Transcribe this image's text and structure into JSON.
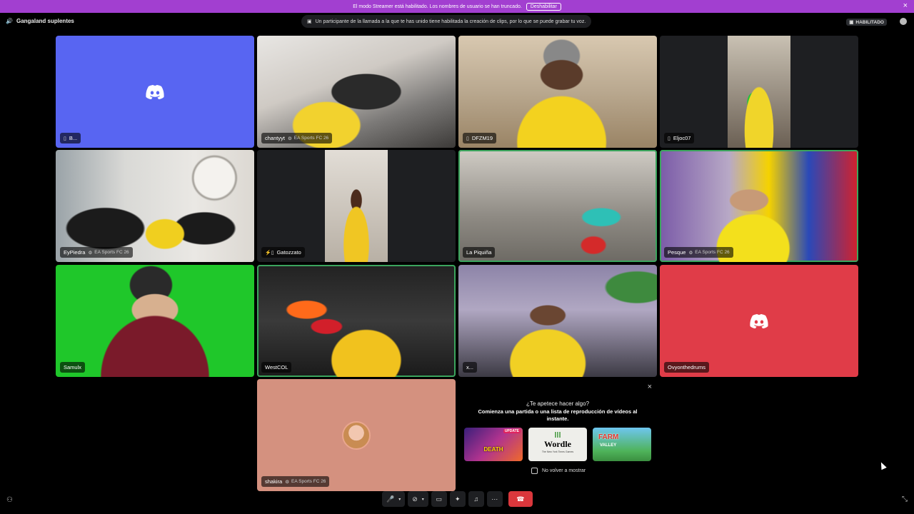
{
  "banner": {
    "text": "El modo Streamer está habilitado. Los nombres de usuario se han truncado.",
    "button": "Deshabilitar",
    "close_icon": "close-icon"
  },
  "topbar": {
    "channel": "Gangaland suplentes",
    "notice": "Un participante de la llamada a la que te has unido tiene habilitada la creación de clips, por lo que se puede grabar tu voz.",
    "badge": "HABILITADO"
  },
  "tiles": [
    {
      "name": "B...",
      "game": "",
      "icon": "mobile-icon"
    },
    {
      "name": "chantyyt",
      "game": "EA Sports FC 26",
      "icon": ""
    },
    {
      "name": "DFZM19",
      "game": "",
      "icon": "mobile-icon"
    },
    {
      "name": "Eljoc07",
      "game": "",
      "icon": "mobile-icon"
    },
    {
      "name": "EyPiedra",
      "game": "EA Sports FC 26",
      "icon": ""
    },
    {
      "name": "Gatozzato",
      "game": "",
      "icon": "muted-mobile-icon"
    },
    {
      "name": "La Piquiña",
      "game": "",
      "icon": ""
    },
    {
      "name": "Pesque",
      "game": "EA Sports FC 26",
      "icon": ""
    },
    {
      "name": "Samulx",
      "game": "",
      "icon": ""
    },
    {
      "name": "WestCOL",
      "game": "",
      "icon": ""
    },
    {
      "name": "x...",
      "game": "",
      "icon": ""
    },
    {
      "name": "Ovyonthedrums",
      "game": "",
      "icon": ""
    },
    {
      "name": "shakira",
      "game": "EA Sports FC 26",
      "icon": ""
    }
  ],
  "activity": {
    "title": "¿Te apetece hacer algo?",
    "subtitle": "Comienza una partida o una lista de reproducción de vídeos al instante.",
    "games": [
      {
        "name": "DEATH",
        "badge": "UPDATE"
      },
      {
        "name": "Wordle",
        "caption": "The New York Times Games"
      },
      {
        "name": "FARM",
        "caption": "VALLEY"
      }
    ],
    "dont_show": "No volver a mostrar"
  },
  "colors": {
    "banner": "#a23fd0",
    "discord_blurple": "#5865f2",
    "red_tile": "#e03c48",
    "peach_tile": "#d4917f",
    "speaking": "#3ba55d",
    "hangup": "#da373c"
  }
}
